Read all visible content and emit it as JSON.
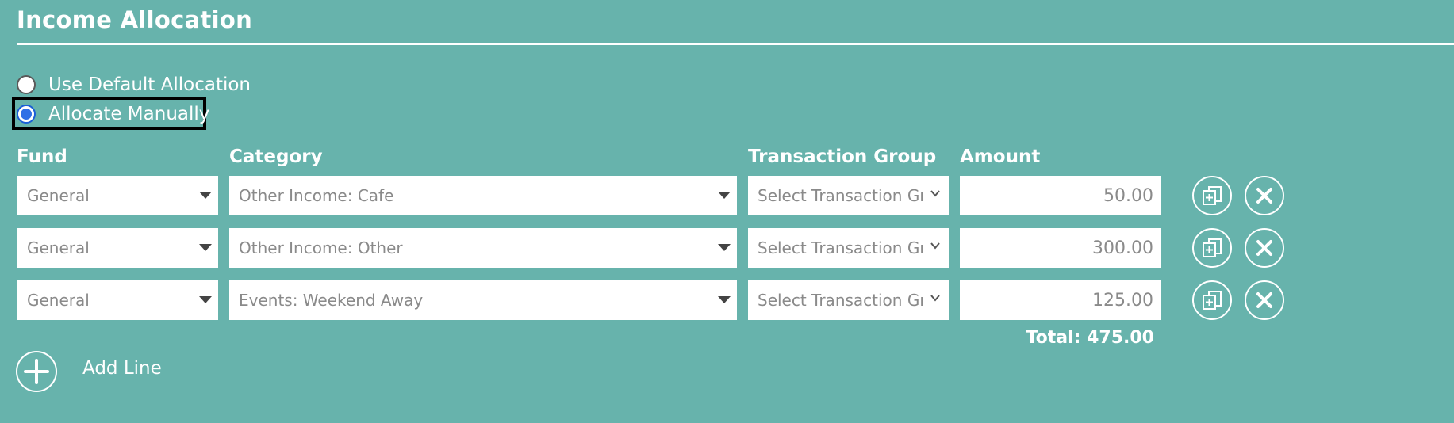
{
  "section": {
    "title": "Income Allocation"
  },
  "allocation_mode": {
    "options": [
      {
        "label": "Use Default Allocation",
        "selected": false
      },
      {
        "label": "Allocate Manually",
        "selected": true
      }
    ]
  },
  "columns": {
    "fund": "Fund",
    "category": "Category",
    "transaction_group": "Transaction Group",
    "amount": "Amount"
  },
  "lines": [
    {
      "fund": "General",
      "category": "Other Income: Cafe",
      "transaction_group": "Select Transaction Grc",
      "amount": "50.00"
    },
    {
      "fund": "General",
      "category": "Other Income: Other",
      "transaction_group": "Select Transaction Grc",
      "amount": "300.00"
    },
    {
      "fund": "General",
      "category": "Events: Weekend Away",
      "transaction_group": "Select Transaction Grc",
      "amount": "125.00"
    }
  ],
  "total": {
    "label": "Total: 475.00"
  },
  "add_line": {
    "label": "Add Line"
  },
  "icons": {
    "copy": "copy-line-icon",
    "remove": "remove-line-icon",
    "add": "plus-icon",
    "dropdown": "caret-down-icon"
  },
  "colors": {
    "background": "#67b3ac",
    "text": "#ffffff",
    "radio_checked": "#2f6fe6",
    "focus_outline": "#000000",
    "field_text": "#8a8a8a"
  }
}
